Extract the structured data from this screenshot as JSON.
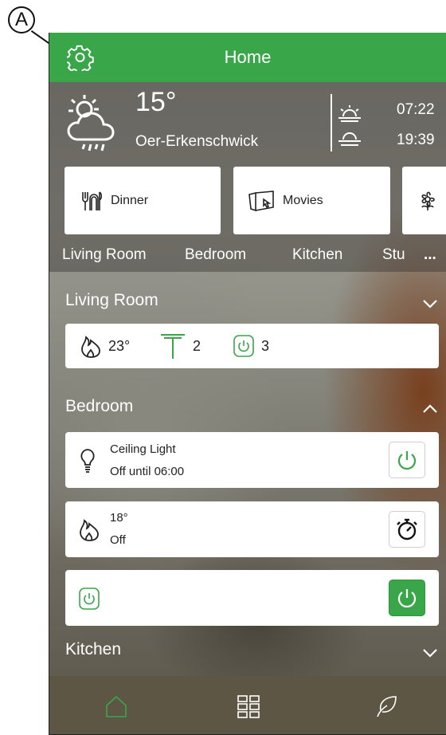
{
  "callout": "A",
  "header": {
    "title": "Home",
    "accent": "#3aa64a"
  },
  "weather": {
    "temperature": "15°",
    "location": "Oer-Erkenschwick",
    "sunrise": "07:22",
    "sunset": "19:39",
    "icon": "cloud-sun-rain-icon"
  },
  "scenes": [
    {
      "label": "Dinner",
      "icon": "dinner-icon"
    },
    {
      "label": "Movies",
      "icon": "movies-icon"
    },
    {
      "label": "",
      "icon": "flower-icon"
    }
  ],
  "tabs": [
    "Living Room",
    "Bedroom",
    "Kitchen",
    "Stu",
    "..."
  ],
  "living_room": {
    "title": "Living Room",
    "temperature": "23°",
    "blinds_count": "2",
    "plugs_count": "3"
  },
  "bedroom": {
    "title": "Bedroom",
    "light": {
      "name": "Ceiling Light",
      "status": "Off until 06:00"
    },
    "heating": {
      "temperature": "18°",
      "status": "Off"
    },
    "plug": {
      "state": "on"
    }
  },
  "kitchen": {
    "title": "Kitchen"
  },
  "bottom_nav": [
    "home-icon",
    "grid-icon",
    "leaf-icon"
  ]
}
